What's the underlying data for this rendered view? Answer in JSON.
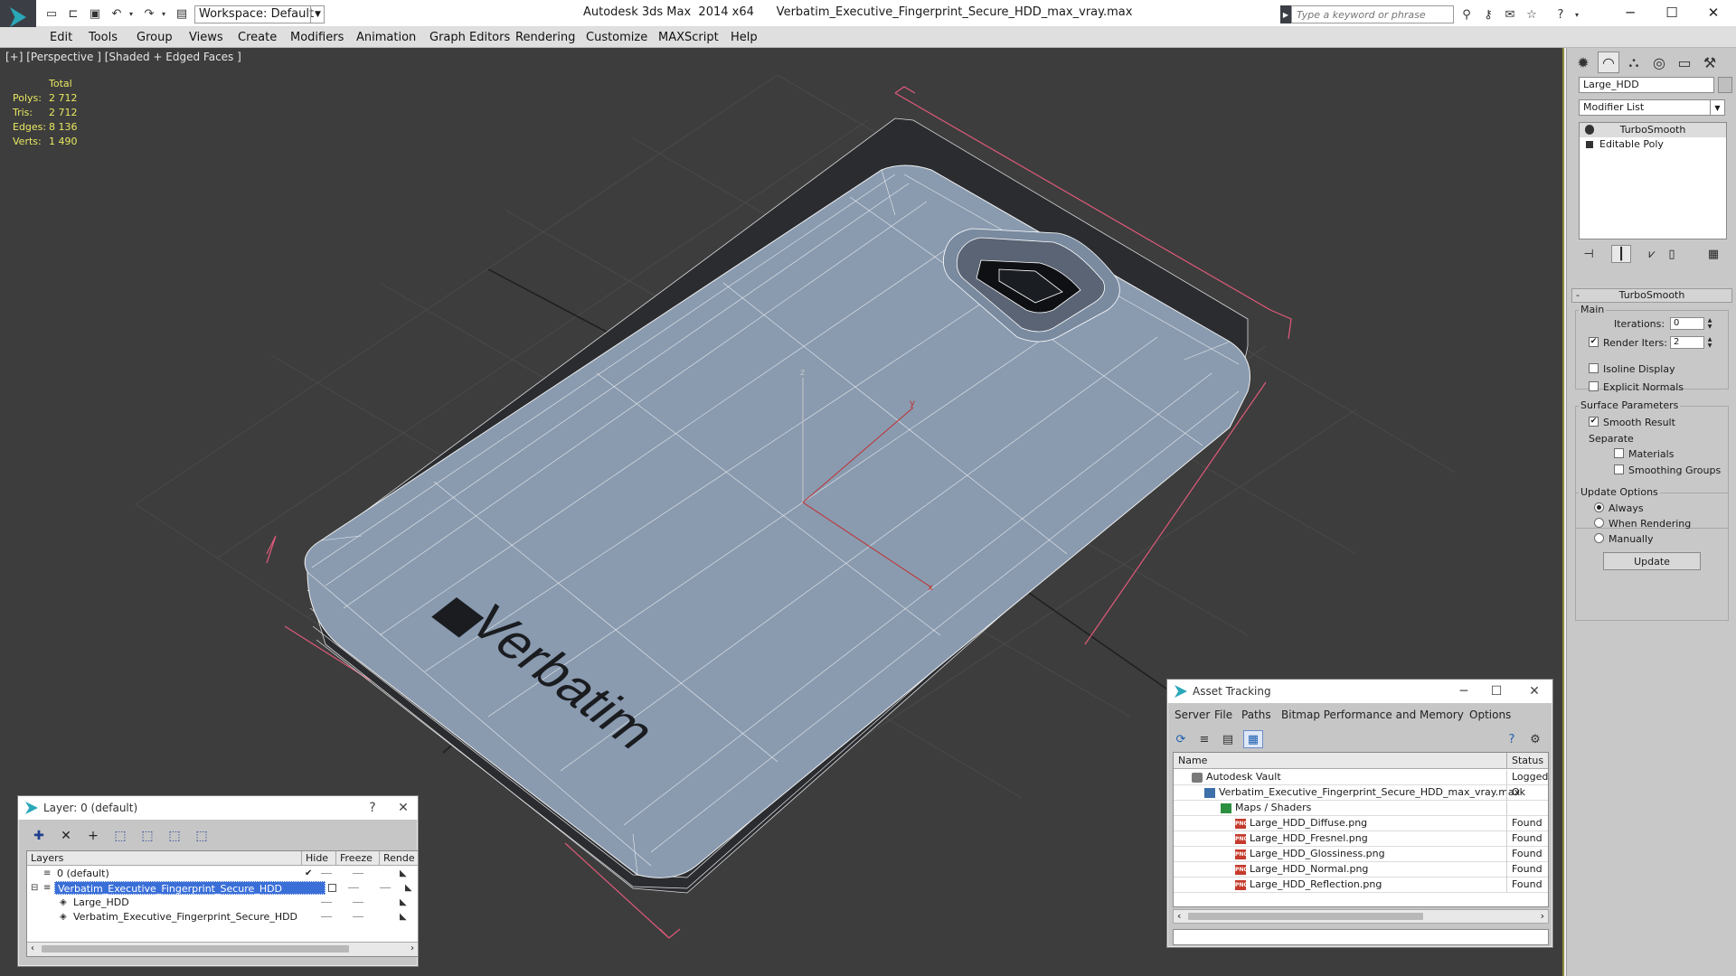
{
  "app": {
    "title": "Autodesk 3ds Max  2014 x64      Verbatim_Executive_Fingerprint_Secure_HDD_max_vray.max",
    "workspace": "Workspace: Default",
    "search_placeholder": "Type a keyword or phrase"
  },
  "menu": [
    "Edit",
    "Tools",
    "Group",
    "Views",
    "Create",
    "Modifiers",
    "Animation",
    "Graph Editors",
    "Rendering",
    "Customize",
    "MAXScript",
    "Help"
  ],
  "viewport": {
    "label": "[+] [Perspective ] [Shaded + Edged Faces ]",
    "stats_header": "Total",
    "stats": [
      {
        "k": "Polys:",
        "v": "2 712"
      },
      {
        "k": "Tris:",
        "v": "2 712"
      },
      {
        "k": "Edges:",
        "v": "8 136"
      },
      {
        "k": "Verts:",
        "v": "1 490"
      }
    ],
    "brand_text": "Verbatim",
    "axis_labels": {
      "y": "y",
      "x": "x",
      "z": "z"
    },
    "colors": {
      "background": "#3d3d3d",
      "mesh": "#8a9bb0",
      "wire": "#ffffff",
      "selection": "#e05a7a",
      "axis": "#c03030"
    }
  },
  "command_panel": {
    "object_name": "Large_HDD",
    "modifier_list": "Modifier List",
    "stack": [
      "TurboSmooth",
      "Editable Poly"
    ],
    "rollout": "TurboSmooth",
    "main_group": "Main",
    "iterations_label": "Iterations:",
    "iterations": "0",
    "render_iters_label": "Render Iters:",
    "render_iters": "2",
    "isoline": "Isoline Display",
    "explicit_normals": "Explicit Normals",
    "surface_group": "Surface Parameters",
    "smooth_result": "Smooth Result",
    "separate": "Separate",
    "materials": "Materials",
    "smoothing_groups": "Smoothing Groups",
    "update_group": "Update Options",
    "always": "Always",
    "when_rendering": "When Rendering",
    "manually": "Manually",
    "update_button": "Update"
  },
  "layer_dialog": {
    "title": "Layer: 0 (default)",
    "help": "?",
    "close": "✕",
    "columns": [
      "Layers",
      "Hide",
      "Freeze",
      "Rende"
    ],
    "rows": [
      {
        "name": "0 (default)",
        "level": 0,
        "selected": false
      },
      {
        "name": "Verbatim_Executive_Fingerprint_Secure_HDD",
        "level": 0,
        "selected": true
      },
      {
        "name": "Large_HDD",
        "level": 1,
        "selected": false
      },
      {
        "name": "Verbatim_Executive_Fingerprint_Secure_HDD",
        "level": 1,
        "selected": false
      }
    ]
  },
  "asset_dialog": {
    "title": "Asset Tracking",
    "menu": [
      "Server",
      "File",
      "Paths",
      "Bitmap Performance and Memory",
      "Options"
    ],
    "columns": [
      "Name",
      "Status"
    ],
    "rows": [
      {
        "name": "Autodesk Vault",
        "status": "Logged",
        "kind": "vault",
        "level": 0
      },
      {
        "name": "Verbatim_Executive_Fingerprint_Secure_HDD_max_vray.max",
        "status": "Ok",
        "kind": "maxfile",
        "level": 1
      },
      {
        "name": "Maps / Shaders",
        "status": "",
        "kind": "folder",
        "level": 2
      },
      {
        "name": "Large_HDD_Diffuse.png",
        "status": "Found",
        "kind": "png",
        "level": 3
      },
      {
        "name": "Large_HDD_Fresnel.png",
        "status": "Found",
        "kind": "png",
        "level": 3
      },
      {
        "name": "Large_HDD_Glossiness.png",
        "status": "Found",
        "kind": "png",
        "level": 3
      },
      {
        "name": "Large_HDD_Normal.png",
        "status": "Found",
        "kind": "png",
        "level": 3
      },
      {
        "name": "Large_HDD_Reflection.png",
        "status": "Found",
        "kind": "png",
        "level": 3
      }
    ]
  }
}
